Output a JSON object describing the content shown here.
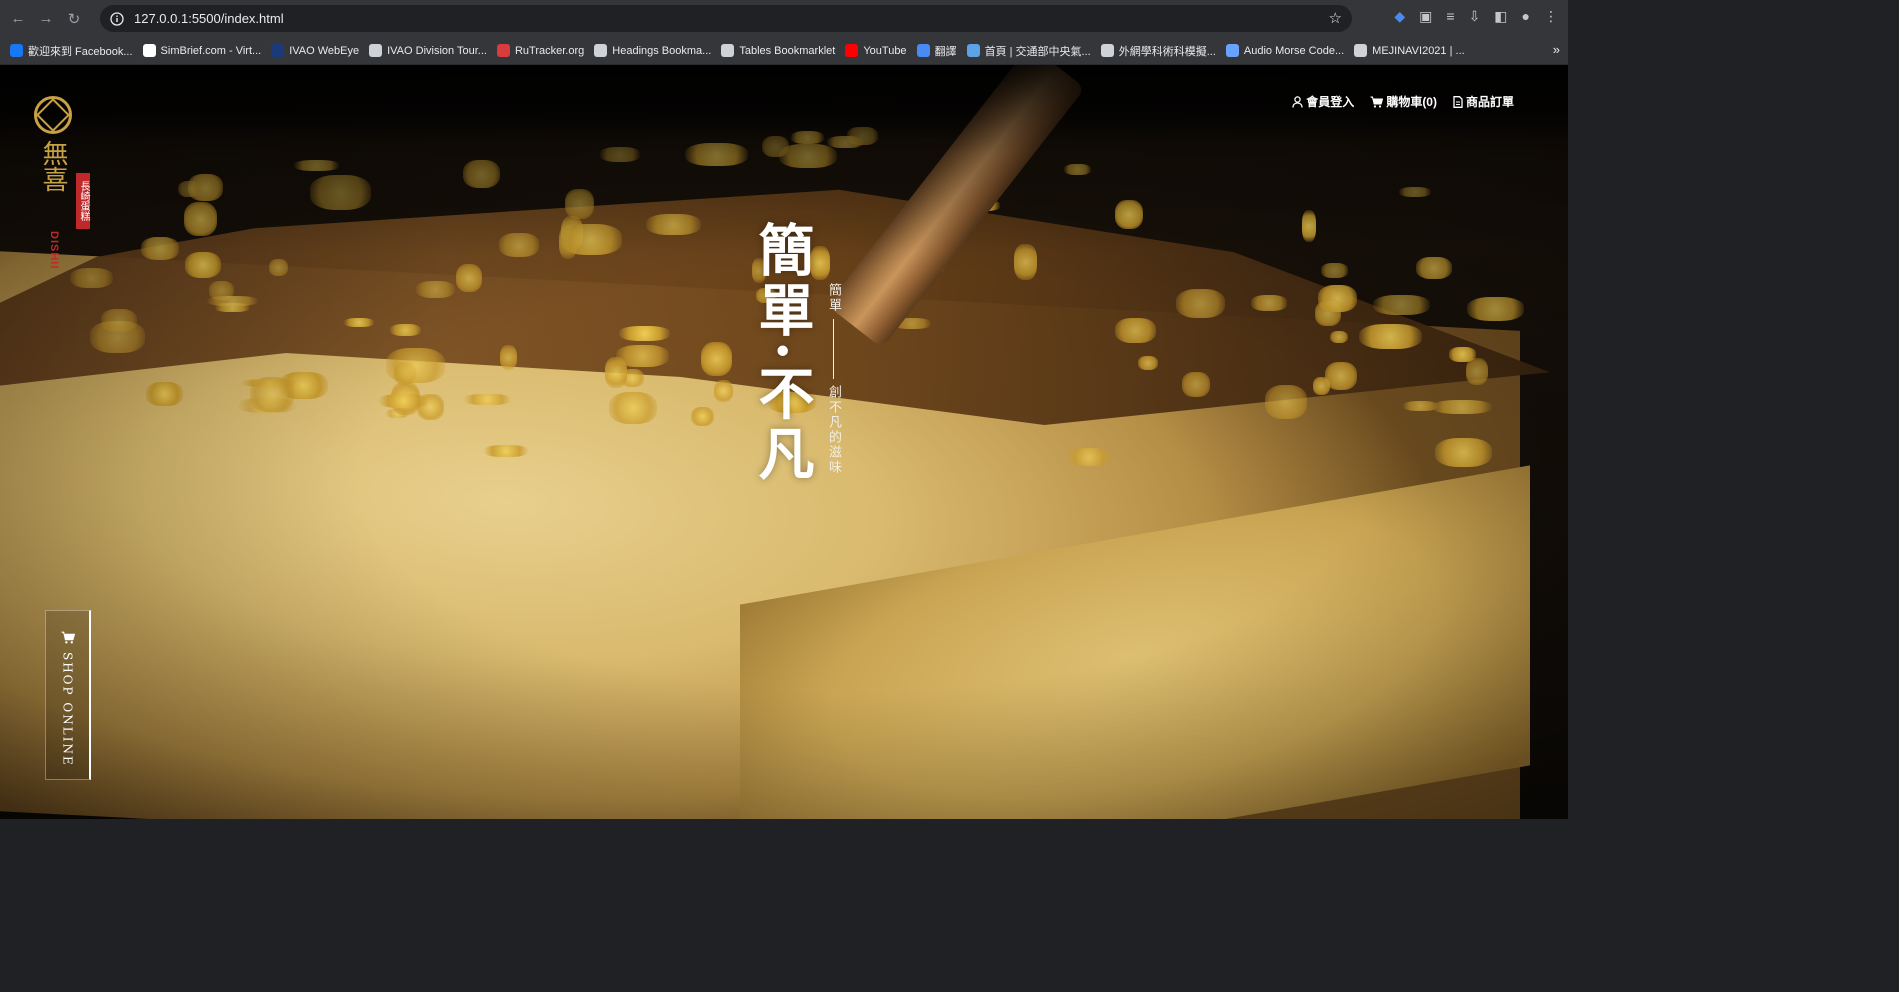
{
  "browser": {
    "url": "127.0.0.1:5500/index.html",
    "bookmarks": [
      {
        "label": "歡迎來到 Facebook...",
        "color": "#1877f2"
      },
      {
        "label": "SimBrief.com - Virt...",
        "color": "#ffffff"
      },
      {
        "label": "IVAO WebEye",
        "color": "#1b3a7a"
      },
      {
        "label": "IVAO Division Tour...",
        "color": "#cfd3d8"
      },
      {
        "label": "RuTracker.org",
        "color": "#d93c3c"
      },
      {
        "label": "Headings Bookma...",
        "color": "#cfd3d8"
      },
      {
        "label": "Tables Bookmarklet",
        "color": "#cfd3d8"
      },
      {
        "label": "YouTube",
        "color": "#ff0000"
      },
      {
        "label": "翻譯",
        "color": "#4a8af4"
      },
      {
        "label": "首頁 | 交通部中央氣...",
        "color": "#5ba3e6"
      },
      {
        "label": "外網學科術科模擬...",
        "color": "#cfd3d8"
      },
      {
        "label": "Audio Morse Code...",
        "color": "#6aa2ff"
      },
      {
        "label": "MEJINAVI2021 | ...",
        "color": "#cfd3d8"
      }
    ],
    "more": "»"
  },
  "site": {
    "logo_cn": "無喜",
    "seal": "長崎蛋糕",
    "logo_en": "DISHII",
    "nav": {
      "login": "會員登入",
      "cart": "購物車(0)",
      "orders": "商品訂單"
    },
    "tagline": {
      "main": "簡單·不凡",
      "sub_top": "簡單",
      "sub_bottom": "創不凡的滋味"
    },
    "shop_online": "SHOP ONLINE"
  }
}
